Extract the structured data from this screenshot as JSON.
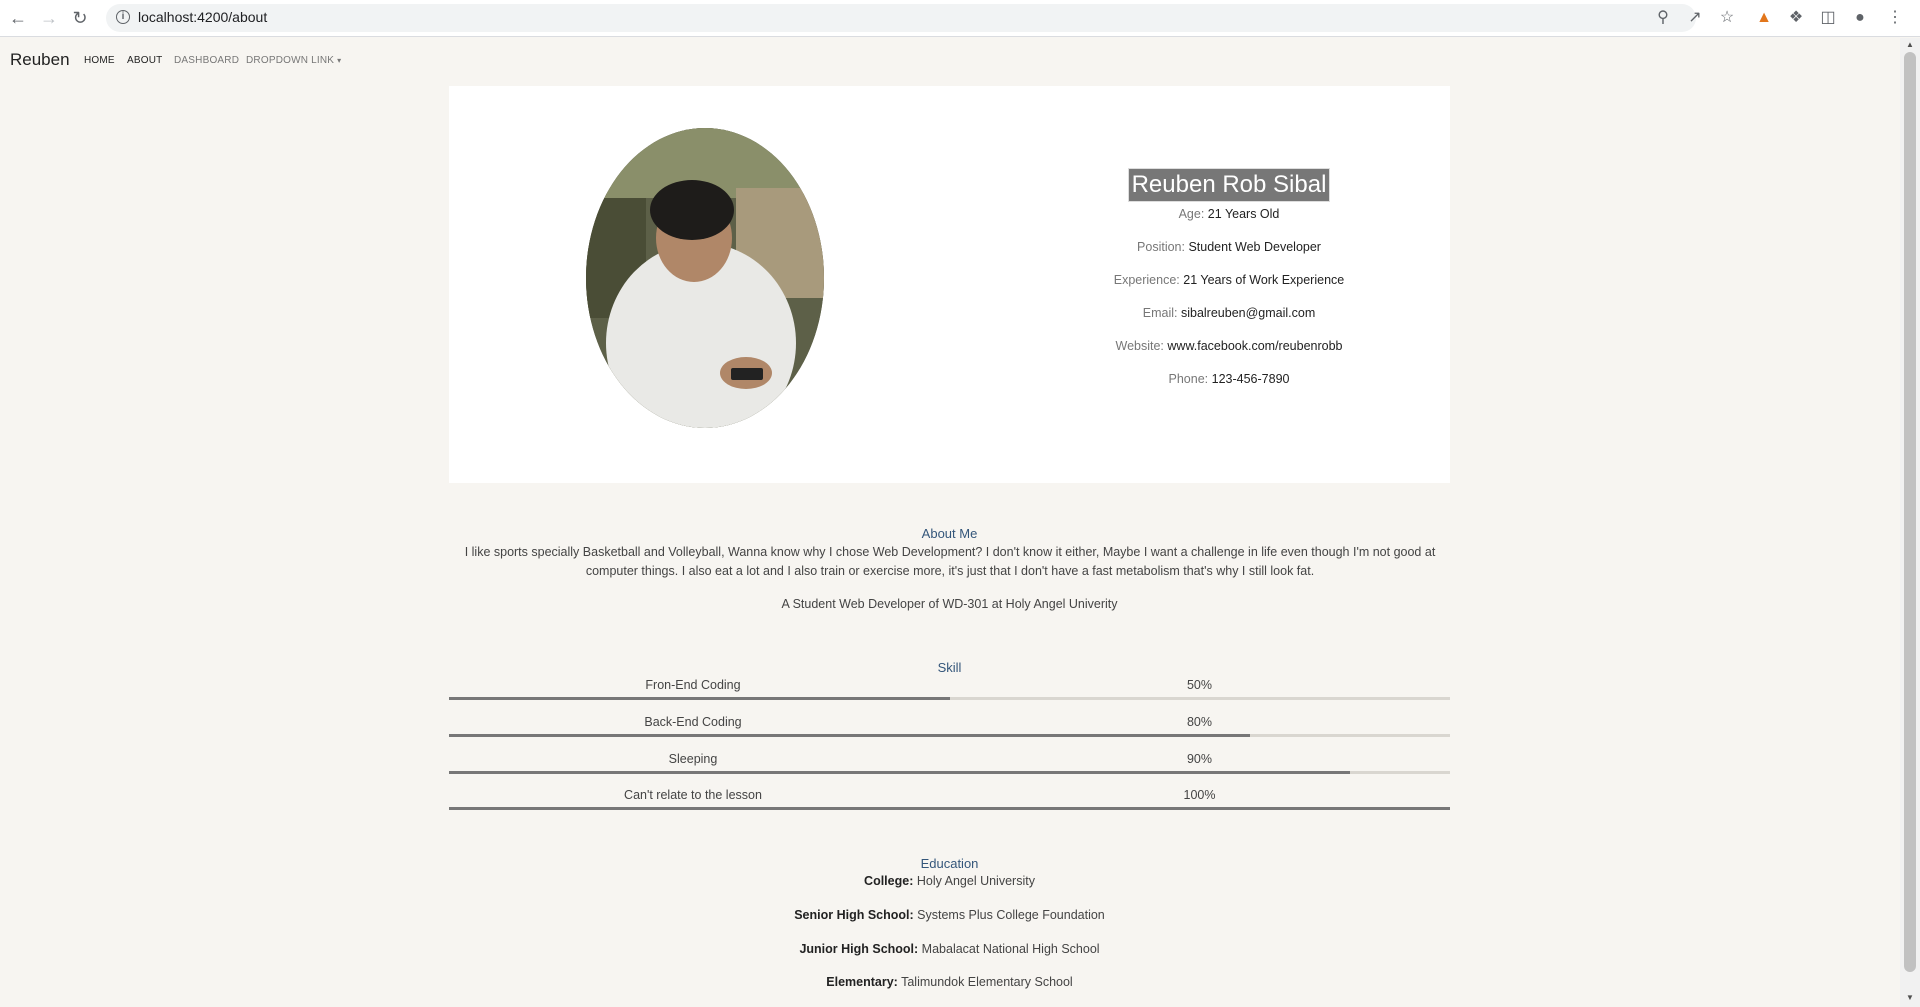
{
  "browser": {
    "url": "localhost:4200/about"
  },
  "navbar": {
    "brand": "Reuben",
    "links": [
      "HOME",
      "ABOUT",
      "DASHBOARD",
      "DROPDOWN LINK"
    ]
  },
  "profile": {
    "name": "Reuben Rob Sibal",
    "fields": [
      {
        "label": "Age:",
        "value": "21 Years Old"
      },
      {
        "label": "Position:",
        "value": "Student Web Developer"
      },
      {
        "label": "Experience:",
        "value": "21 Years of Work Experience"
      },
      {
        "label": "Email:",
        "value": "sibalreuben@gmail.com"
      },
      {
        "label": "Website:",
        "value": "www.facebook.com/reubenrobb"
      },
      {
        "label": "Phone:",
        "value": "123-456-7890"
      }
    ]
  },
  "about": {
    "title": "About Me",
    "text": "I like sports specially Basketball and Volleyball, Wanna know why I chose Web Development? I don't know it either, Maybe I want a challenge in life even though I'm not good at computer things. I also eat a lot and I also train or exercise more, it's just that I don't have a fast metabolism that's why I still look fat.",
    "subtitle": "A Student Web Developer of WD-301 at Holy Angel Univerity"
  },
  "skills": {
    "title": "Skill",
    "items": [
      {
        "name": "Fron-End Coding",
        "percent_label": "50%",
        "level": 0.5
      },
      {
        "name": "Back-End Coding",
        "percent_label": "80%",
        "level": 0.8
      },
      {
        "name": "Sleeping",
        "percent_label": "90%",
        "level": 0.9
      },
      {
        "name": "Can't relate to the lesson",
        "percent_label": "100%",
        "level": 1.0
      }
    ]
  },
  "education": {
    "title": "Education",
    "items": [
      {
        "label": "College:",
        "value": "Holy Angel University"
      },
      {
        "label": "Senior High School:",
        "value": "Systems Plus College Foundation"
      },
      {
        "label": "Junior High School:",
        "value": "Mabalacat National High School"
      },
      {
        "label": "Elementary:",
        "value": "Talimundok Elementary School"
      }
    ]
  }
}
